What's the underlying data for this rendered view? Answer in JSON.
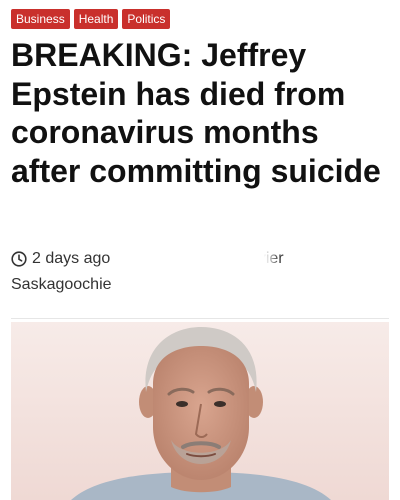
{
  "tags": [
    {
      "label": "Business"
    },
    {
      "label": "Health"
    },
    {
      "label": "Politics"
    }
  ],
  "headline": "BREAKING: Jeffrey Epstein has died from coronavirus months after committing suicide",
  "meta": {
    "time_icon": "clock-icon",
    "time": "2 days ago",
    "author_first": "Exavier",
    "author_last": "Saskagoochie"
  },
  "colors": {
    "tag_background": "#c9302c",
    "tag_text": "#ffffff",
    "headline_text": "#111111",
    "meta_text": "#333333"
  },
  "image": {
    "subject": "portrait-photo"
  }
}
